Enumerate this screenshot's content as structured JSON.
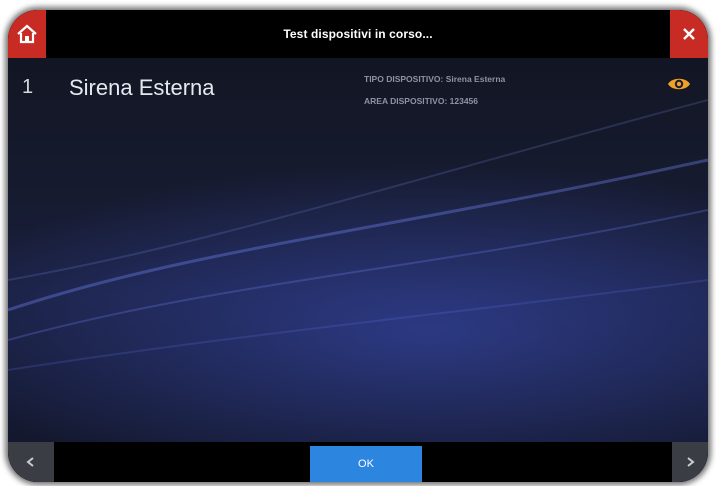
{
  "header": {
    "title": "Test dispositivi in corso..."
  },
  "device": {
    "index": "1",
    "name": "Sirena Esterna",
    "type_line": "TIPO DISPOSITIVO: Sirena Esterna",
    "area_line": "AREA DISPOSITIVO: 123456"
  },
  "footer": {
    "ok_label": "OK"
  },
  "icons": {
    "home": "home-icon",
    "close": "close-icon",
    "view": "eye-icon",
    "prev": "chevron-left-icon",
    "next": "chevron-right-icon"
  },
  "colors": {
    "accent_red": "#c72b23",
    "ok_blue": "#2c85df",
    "eye_orange": "#f0a12a"
  }
}
